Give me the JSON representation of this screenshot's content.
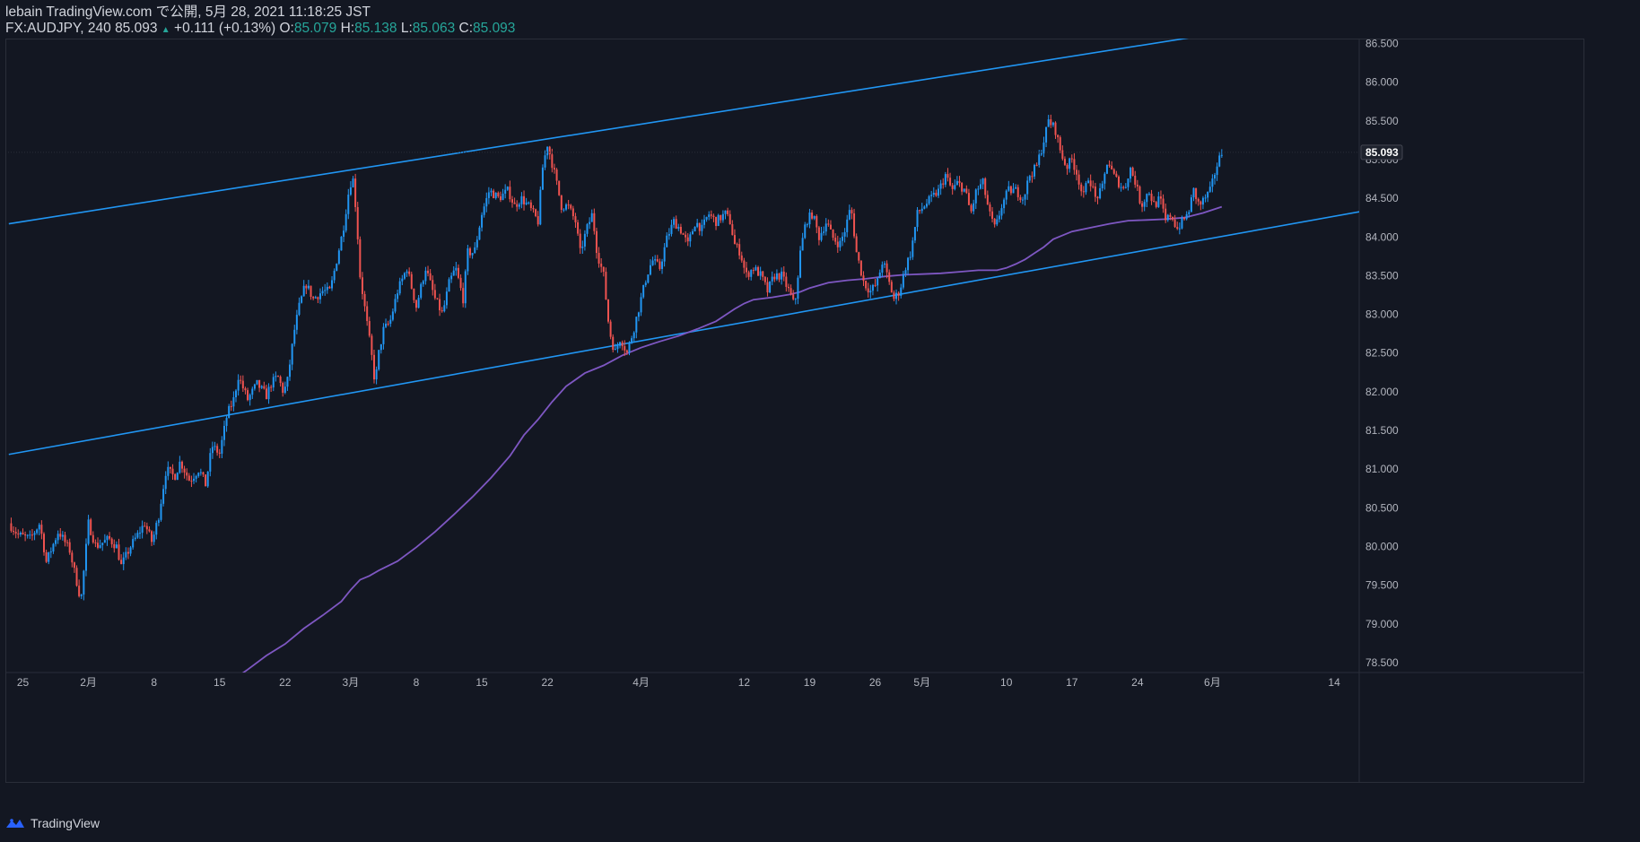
{
  "header": {
    "published_by": "lebain TradingView.com で公開, 5月 28, 2021 11:18:25 JST",
    "symbol": "FX:AUDJPY, 240",
    "last": "85.093",
    "change_arrow": "▲",
    "change": "+0.111 (+0.13%)",
    "o_label": "O:",
    "o_value": "85.079",
    "h_label": "H:",
    "h_value": "85.138",
    "l_label": "L:",
    "l_value": "85.063",
    "c_label": "C:",
    "c_value": "85.093"
  },
  "footer": {
    "brand": "TradingView"
  },
  "colors": {
    "background": "#131722",
    "up": "#2196f3",
    "down": "#ef5350",
    "ma": "#7e57c2",
    "trendline": "#2196f3",
    "axis_text": "#b2b5be",
    "price_badge_bg": "#1e222d"
  },
  "chart_data": {
    "type": "candlestick",
    "symbol": "FX:AUDJPY",
    "timeframe": "240",
    "ylim": [
      78.3,
      86.7
    ],
    "y_ticks": [
      "86.500",
      "86.000",
      "85.500",
      "85.000",
      "84.500",
      "84.000",
      "83.500",
      "83.000",
      "82.500",
      "82.000",
      "81.500",
      "81.000",
      "80.500",
      "80.000",
      "79.500",
      "79.000",
      "78.500"
    ],
    "x_ticks": [
      {
        "label": "25",
        "day": 0
      },
      {
        "label": "2月",
        "day": 7
      },
      {
        "label": "8",
        "day": 14
      },
      {
        "label": "15",
        "day": 21
      },
      {
        "label": "22",
        "day": 28
      },
      {
        "label": "3月",
        "day": 35
      },
      {
        "label": "8",
        "day": 42
      },
      {
        "label": "15",
        "day": 49
      },
      {
        "label": "22",
        "day": 56
      },
      {
        "label": "4月",
        "day": 66
      },
      {
        "label": "12",
        "day": 77
      },
      {
        "label": "19",
        "day": 84
      },
      {
        "label": "26",
        "day": 91
      },
      {
        "label": "5月",
        "day": 96
      },
      {
        "label": "10",
        "day": 105
      },
      {
        "label": "17",
        "day": 112
      },
      {
        "label": "24",
        "day": 119
      },
      {
        "label": "6月",
        "day": 127
      },
      {
        "label": "14",
        "day": 140
      }
    ],
    "current_price_label": "85.093",
    "current_price": 85.093,
    "price_anchors": [
      [
        -1.5,
        80.3
      ],
      [
        -0.5,
        80.15
      ],
      [
        0.8,
        80.1
      ],
      [
        1.8,
        80.3
      ],
      [
        2.5,
        79.8
      ],
      [
        3.8,
        80.2
      ],
      [
        5,
        79.95
      ],
      [
        6.2,
        79.3
      ],
      [
        7,
        80.3
      ],
      [
        7.8,
        80.0
      ],
      [
        9.2,
        80.1
      ],
      [
        10,
        80.0
      ],
      [
        10.5,
        79.75
      ],
      [
        11.5,
        80.0
      ],
      [
        13,
        80.3
      ],
      [
        13.8,
        80.05
      ],
      [
        14.5,
        80.4
      ],
      [
        15.3,
        81.0
      ],
      [
        16.2,
        80.9
      ],
      [
        16.8,
        81.1
      ],
      [
        17.8,
        80.85
      ],
      [
        18.8,
        81.0
      ],
      [
        19.5,
        80.8
      ],
      [
        20.2,
        81.3
      ],
      [
        21,
        81.2
      ],
      [
        21.8,
        81.7
      ],
      [
        22.5,
        81.9
      ],
      [
        23,
        82.2
      ],
      [
        24,
        81.9
      ],
      [
        25,
        82.1
      ],
      [
        26,
        81.95
      ],
      [
        26.5,
        82.1
      ],
      [
        27.2,
        82.2
      ],
      [
        27.8,
        82.0
      ],
      [
        28.2,
        82.1
      ],
      [
        29,
        82.8
      ],
      [
        29.5,
        83.1
      ],
      [
        30.2,
        83.4
      ],
      [
        31,
        83.2
      ],
      [
        32,
        83.3
      ],
      [
        32.8,
        83.3
      ],
      [
        33.5,
        83.7
      ],
      [
        34.2,
        84.1
      ],
      [
        34.8,
        84.6
      ],
      [
        35.2,
        84.8
      ],
      [
        35.6,
        84.3
      ],
      [
        36,
        83.5
      ],
      [
        36.6,
        83.0
      ],
      [
        37.2,
        82.5
      ],
      [
        37.6,
        82.1
      ],
      [
        38,
        82.5
      ],
      [
        38.5,
        82.8
      ],
      [
        39.2,
        82.9
      ],
      [
        40,
        83.3
      ],
      [
        41,
        83.6
      ],
      [
        42,
        83.1
      ],
      [
        43,
        83.6
      ],
      [
        44,
        83.2
      ],
      [
        44.8,
        83.0
      ],
      [
        45.5,
        83.4
      ],
      [
        46.2,
        83.6
      ],
      [
        47,
        83.2
      ],
      [
        47.5,
        83.8
      ],
      [
        48.2,
        83.8
      ],
      [
        49,
        84.3
      ],
      [
        49.8,
        84.6
      ],
      [
        50.8,
        84.5
      ],
      [
        51.8,
        84.6
      ],
      [
        52.5,
        84.4
      ],
      [
        53.2,
        84.5
      ],
      [
        54,
        84.4
      ],
      [
        55,
        84.2
      ],
      [
        55.5,
        84.9
      ],
      [
        56,
        85.2
      ],
      [
        56.8,
        84.8
      ],
      [
        57.5,
        84.4
      ],
      [
        58.2,
        84.4
      ],
      [
        59,
        84.2
      ],
      [
        59.5,
        83.8
      ],
      [
        60.2,
        84.1
      ],
      [
        60.8,
        84.3
      ],
      [
        61.3,
        83.8
      ],
      [
        62,
        83.5
      ],
      [
        62.6,
        82.8
      ],
      [
        63.2,
        82.5
      ],
      [
        63.8,
        82.7
      ],
      [
        64.5,
        82.5
      ],
      [
        65.2,
        82.8
      ],
      [
        66,
        83.2
      ],
      [
        66.6,
        83.5
      ],
      [
        67.2,
        83.7
      ],
      [
        68,
        83.6
      ],
      [
        68.8,
        84.0
      ],
      [
        69.5,
        84.2
      ],
      [
        70.2,
        84.1
      ],
      [
        71,
        83.9
      ],
      [
        71.8,
        84.2
      ],
      [
        72.5,
        84.1
      ],
      [
        73.2,
        84.3
      ],
      [
        74,
        84.2
      ],
      [
        75,
        84.3
      ],
      [
        75.5,
        84.2
      ],
      [
        76,
        83.9
      ],
      [
        76.6,
        83.8
      ],
      [
        77.2,
        83.5
      ],
      [
        78,
        83.6
      ],
      [
        78.8,
        83.5
      ],
      [
        79.5,
        83.3
      ],
      [
        80.2,
        83.5
      ],
      [
        81,
        83.5
      ],
      [
        81.8,
        83.3
      ],
      [
        82.4,
        83.1
      ],
      [
        83,
        83.8
      ],
      [
        83.6,
        84.2
      ],
      [
        84.3,
        84.3
      ],
      [
        85,
        84.0
      ],
      [
        85.8,
        84.2
      ],
      [
        86.4,
        84.0
      ],
      [
        87.2,
        83.9
      ],
      [
        87.8,
        84.1
      ],
      [
        88.4,
        84.4
      ],
      [
        89,
        83.8
      ],
      [
        89.8,
        83.4
      ],
      [
        90.5,
        83.3
      ],
      [
        91.2,
        83.4
      ],
      [
        91.8,
        83.7
      ],
      [
        92.5,
        83.4
      ],
      [
        93,
        83.2
      ],
      [
        93.6,
        83.3
      ],
      [
        94.2,
        83.6
      ],
      [
        94.8,
        83.8
      ],
      [
        95.5,
        84.3
      ],
      [
        96.2,
        84.4
      ],
      [
        97,
        84.5
      ],
      [
        97.8,
        84.6
      ],
      [
        98.5,
        84.8
      ],
      [
        99.2,
        84.6
      ],
      [
        99.8,
        84.7
      ],
      [
        100.6,
        84.6
      ],
      [
        101.2,
        84.3
      ],
      [
        101.8,
        84.6
      ],
      [
        102.5,
        84.7
      ],
      [
        103.2,
        84.3
      ],
      [
        103.8,
        84.1
      ],
      [
        104.5,
        84.4
      ],
      [
        105.2,
        84.6
      ],
      [
        106,
        84.6
      ],
      [
        106.8,
        84.5
      ],
      [
        107.5,
        84.8
      ],
      [
        108.2,
        84.9
      ],
      [
        108.9,
        85.2
      ],
      [
        109.5,
        85.5
      ],
      [
        110.2,
        85.4
      ],
      [
        110.8,
        85.1
      ],
      [
        111.4,
        84.9
      ],
      [
        112,
        85.0
      ],
      [
        112.6,
        84.8
      ],
      [
        113.2,
        84.5
      ],
      [
        113.8,
        84.8
      ],
      [
        114.5,
        84.5
      ],
      [
        115.2,
        84.6
      ],
      [
        115.8,
        85.0
      ],
      [
        116.4,
        84.8
      ],
      [
        117,
        84.7
      ],
      [
        117.6,
        84.6
      ],
      [
        118.2,
        84.9
      ],
      [
        118.8,
        84.7
      ],
      [
        119.4,
        84.4
      ],
      [
        120.2,
        84.6
      ],
      [
        120.8,
        84.4
      ],
      [
        121.4,
        84.5
      ],
      [
        122,
        84.2
      ],
      [
        122.6,
        84.3
      ],
      [
        123.2,
        84.1
      ],
      [
        123.8,
        84.2
      ],
      [
        124.4,
        84.3
      ],
      [
        125,
        84.6
      ],
      [
        125.6,
        84.4
      ],
      [
        126.2,
        84.5
      ],
      [
        126.8,
        84.6
      ],
      [
        127.4,
        84.9
      ],
      [
        128,
        85.093
      ]
    ],
    "moving_average": [
      [
        -1.5,
        79.04
      ],
      [
        0,
        79.2
      ],
      [
        2,
        79.32
      ],
      [
        4,
        79.45
      ],
      [
        6,
        79.55
      ],
      [
        8,
        79.62
      ],
      [
        10,
        79.72
      ],
      [
        12,
        79.82
      ],
      [
        14,
        79.92
      ],
      [
        16,
        80.05
      ],
      [
        18,
        80.2
      ],
      [
        20,
        80.38
      ],
      [
        22,
        80.55
      ],
      [
        24,
        80.72
      ],
      [
        26,
        80.9
      ],
      [
        28,
        81.05
      ],
      [
        30,
        81.25
      ],
      [
        32,
        81.42
      ],
      [
        34,
        81.6
      ],
      [
        35,
        81.75
      ],
      [
        36,
        81.88
      ],
      [
        37,
        81.93
      ],
      [
        38,
        82.0
      ],
      [
        40,
        82.12
      ],
      [
        42,
        82.3
      ],
      [
        44,
        82.5
      ],
      [
        46,
        82.72
      ],
      [
        48,
        82.95
      ],
      [
        50,
        83.2
      ],
      [
        52,
        83.48
      ],
      [
        53.5,
        83.75
      ],
      [
        55,
        83.95
      ],
      [
        56.5,
        84.18
      ],
      [
        58,
        84.38
      ],
      [
        60,
        84.55
      ],
      [
        62,
        84.65
      ],
      [
        64,
        84.78
      ],
      [
        66,
        84.88
      ],
      [
        68,
        84.96
      ],
      [
        70,
        85.03
      ],
      [
        72,
        85.12
      ],
      [
        74,
        85.22
      ],
      [
        76,
        85.38
      ],
      [
        77,
        85.45
      ],
      [
        78,
        85.5
      ],
      [
        80,
        85.53
      ],
      [
        82,
        85.57
      ],
      [
        83,
        85.6
      ],
      [
        84,
        85.65
      ],
      [
        86,
        85.72
      ],
      [
        88,
        85.75
      ],
      [
        90,
        85.77
      ],
      [
        92,
        85.8
      ],
      [
        94,
        85.82
      ],
      [
        96,
        85.83
      ],
      [
        98,
        85.84
      ],
      [
        100,
        85.86
      ],
      [
        102,
        85.88
      ],
      [
        104,
        85.88
      ],
      [
        105,
        85.91
      ],
      [
        106,
        85.96
      ],
      [
        107,
        86.02
      ],
      [
        108,
        86.1
      ],
      [
        109,
        86.18
      ],
      [
        110,
        86.28
      ],
      [
        112,
        86.38
      ],
      [
        114,
        86.43
      ],
      [
        116,
        86.48
      ],
      [
        118,
        86.52
      ],
      [
        120,
        86.53
      ],
      [
        122,
        86.54
      ],
      [
        124,
        86.56
      ],
      [
        126,
        86.62
      ],
      [
        128,
        86.7
      ]
    ],
    "ma_offset": -2.31,
    "trendlines": [
      {
        "points": [
          [
            -1.5,
            84.17
          ],
          [
            35.2,
            84.87
          ]
        ]
      },
      {
        "points": [
          [
            -1.5,
            81.19
          ],
          [
            130,
            84.05
          ]
        ]
      }
    ]
  }
}
